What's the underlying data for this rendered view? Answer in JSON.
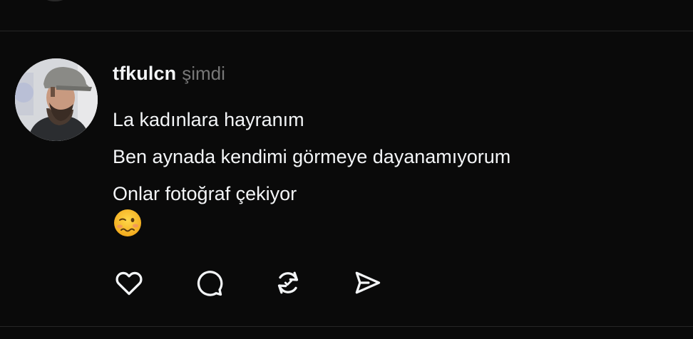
{
  "post": {
    "author": {
      "username": "tfkulcn",
      "avatar_icon": "profile-photo"
    },
    "timestamp": "şimdi",
    "lines": [
      "La kadınlara hayranım",
      "Ben aynada kendimi görmeye dayanamıyorum",
      "Onlar fotoğraf çekiyor"
    ],
    "emoji": "woozy-face-emoji",
    "actions": [
      {
        "name": "like",
        "icon": "heart-icon"
      },
      {
        "name": "reply",
        "icon": "comment-icon"
      },
      {
        "name": "repost",
        "icon": "repost-icon"
      },
      {
        "name": "share",
        "icon": "send-icon"
      }
    ]
  },
  "colors": {
    "background": "#0a0a0a",
    "primary_text": "#f3f5f7",
    "secondary_text": "#777777",
    "divider": "#262626",
    "emoji_yellow": "#f6c22e"
  }
}
